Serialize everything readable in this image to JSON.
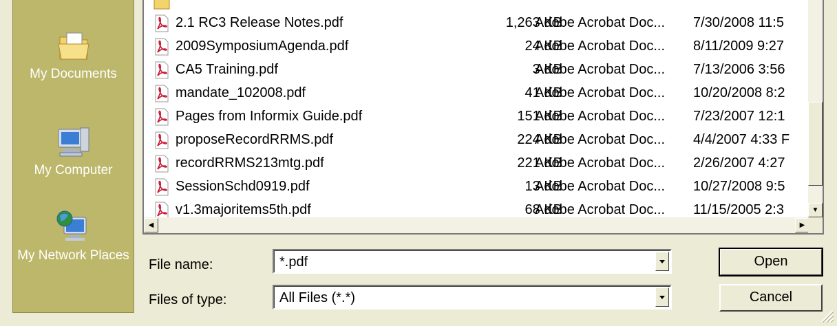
{
  "places": [
    {
      "label": "My Documents",
      "icon": "my-documents-icon"
    },
    {
      "label": "My Computer",
      "icon": "my-computer-icon"
    },
    {
      "label": "My Network Places",
      "icon": "my-network-places-icon"
    }
  ],
  "files": [
    {
      "name": "2.1 RC3 Release Notes.pdf",
      "size": "1,263 KB",
      "type": "Adobe Acrobat Doc...",
      "date": "7/30/2008 11:5"
    },
    {
      "name": "2009SymposiumAgenda.pdf",
      "size": "24 KB",
      "type": "Adobe Acrobat Doc...",
      "date": "8/11/2009 9:27"
    },
    {
      "name": "CA5 Training.pdf",
      "size": "3 KB",
      "type": "Adobe Acrobat Doc...",
      "date": "7/13/2006 3:56"
    },
    {
      "name": "mandate_102008.pdf",
      "size": "41 KB",
      "type": "Adobe Acrobat Doc...",
      "date": "10/20/2008 8:2"
    },
    {
      "name": "Pages from Informix Guide.pdf",
      "size": "151 KB",
      "type": "Adobe Acrobat Doc...",
      "date": "7/23/2007 12:1"
    },
    {
      "name": "proposeRecordRRMS.pdf",
      "size": "224 KB",
      "type": "Adobe Acrobat Doc...",
      "date": "4/4/2007 4:33 F"
    },
    {
      "name": "recordRRMS213mtg.pdf",
      "size": "221 KB",
      "type": "Adobe Acrobat Doc...",
      "date": "2/26/2007 4:27"
    },
    {
      "name": "SessionSchd0919.pdf",
      "size": "13 KB",
      "type": "Adobe Acrobat Doc...",
      "date": "10/27/2008 9:5"
    },
    {
      "name": "v1.3majoritems5th.pdf",
      "size": "68 KB",
      "type": "Adobe Acrobat Doc...",
      "date": "11/15/2005 2:3"
    }
  ],
  "labels": {
    "file_name": "File name:",
    "files_of_type": "Files of type:"
  },
  "file_name_value": "*.pdf",
  "file_type_value": "All Files (*.*)",
  "buttons": {
    "open": "Open",
    "cancel": "Cancel"
  },
  "colors": {
    "places_bar": "#bdb76b",
    "dialog_bg": "#ecebd5",
    "pdf_red": "#c8102e"
  }
}
